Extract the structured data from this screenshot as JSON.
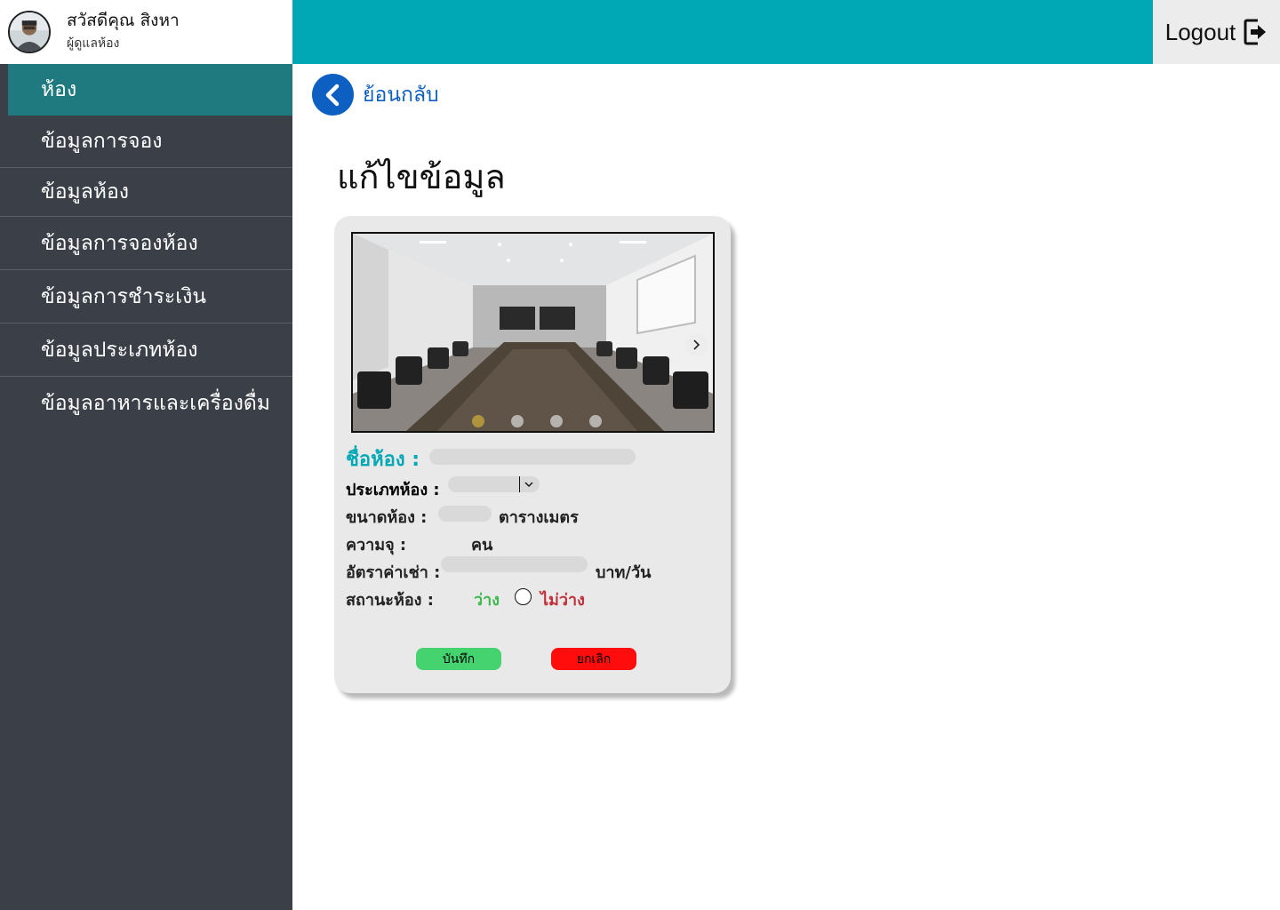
{
  "user": {
    "greeting": "สวัสดีคุณ สิงหา",
    "role": "ผู้ดูแลห้อง"
  },
  "header": {
    "logout_label": "Logout",
    "accent_color": "#00a8b5"
  },
  "sidebar": {
    "items": [
      {
        "label": "ห้อง",
        "active": true
      },
      {
        "label": "ข้อมูลการจอง",
        "active": false
      },
      {
        "label": "ข้อมูลห้อง",
        "active": false
      },
      {
        "label": "ข้อมูลการจองห้อง",
        "active": false
      },
      {
        "label": "ข้อมูลการชำระเงิน",
        "active": false
      },
      {
        "label": "ข้อมูลประเภทห้อง",
        "active": false
      },
      {
        "label": "ข้อมูลอาหารและเครื่องดื่ม",
        "active": false
      }
    ]
  },
  "main": {
    "back_label": "ย้อนกลับ",
    "title": "แก้ไขข้อมูล"
  },
  "form": {
    "carousel": {
      "slide_count": 4,
      "active_index": 0
    },
    "room_name": {
      "label": "ชื่อห้อง :",
      "value": ""
    },
    "room_type": {
      "label": "ประเภทห้อง :",
      "value": ""
    },
    "room_size": {
      "label": "ขนาดห้อง  :",
      "value": "",
      "unit": "ตารางเมตร"
    },
    "capacity": {
      "label": "ความจุ :",
      "value": "",
      "unit": "คน"
    },
    "rent_rate": {
      "label": "อัตราค่าเช่า :",
      "value": "",
      "unit": "บาท/วัน"
    },
    "status": {
      "label": "สถานะห้อง :",
      "option_free": "ว่าง",
      "option_busy": "ไม่ว่าง"
    },
    "save_label": "บันทึก",
    "cancel_label": "ยกเลิก"
  }
}
